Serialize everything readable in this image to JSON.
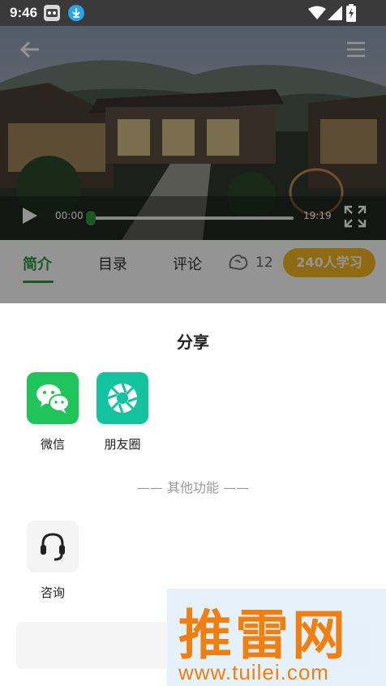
{
  "status_bar": {
    "time": "9:46"
  },
  "player": {
    "current_time": "00:00",
    "duration": "19:19",
    "progress": 0
  },
  "tabs": [
    {
      "label": "简介",
      "active": true
    },
    {
      "label": "目录",
      "active": false
    },
    {
      "label": "评论",
      "active": false
    }
  ],
  "likes": {
    "count": "12"
  },
  "learners_badge": "240人学习",
  "share_sheet": {
    "title": "分享",
    "targets": [
      {
        "label": "微信",
        "icon": "wechat-icon",
        "color": "#1fc55a"
      },
      {
        "label": "朋友圈",
        "icon": "moments-icon",
        "color": "#13c29f"
      }
    ],
    "other_section_label": "—— 其他功能 ——",
    "other_actions": [
      {
        "label": "咨询",
        "icon": "headset-icon"
      }
    ]
  },
  "watermark": {
    "title": "推雷网",
    "url": "www.tuilei.com"
  },
  "colors": {
    "accent_green": "#2a9a3c",
    "badge_yellow": "#f5b921",
    "watermark_orange": "#f07f10"
  }
}
